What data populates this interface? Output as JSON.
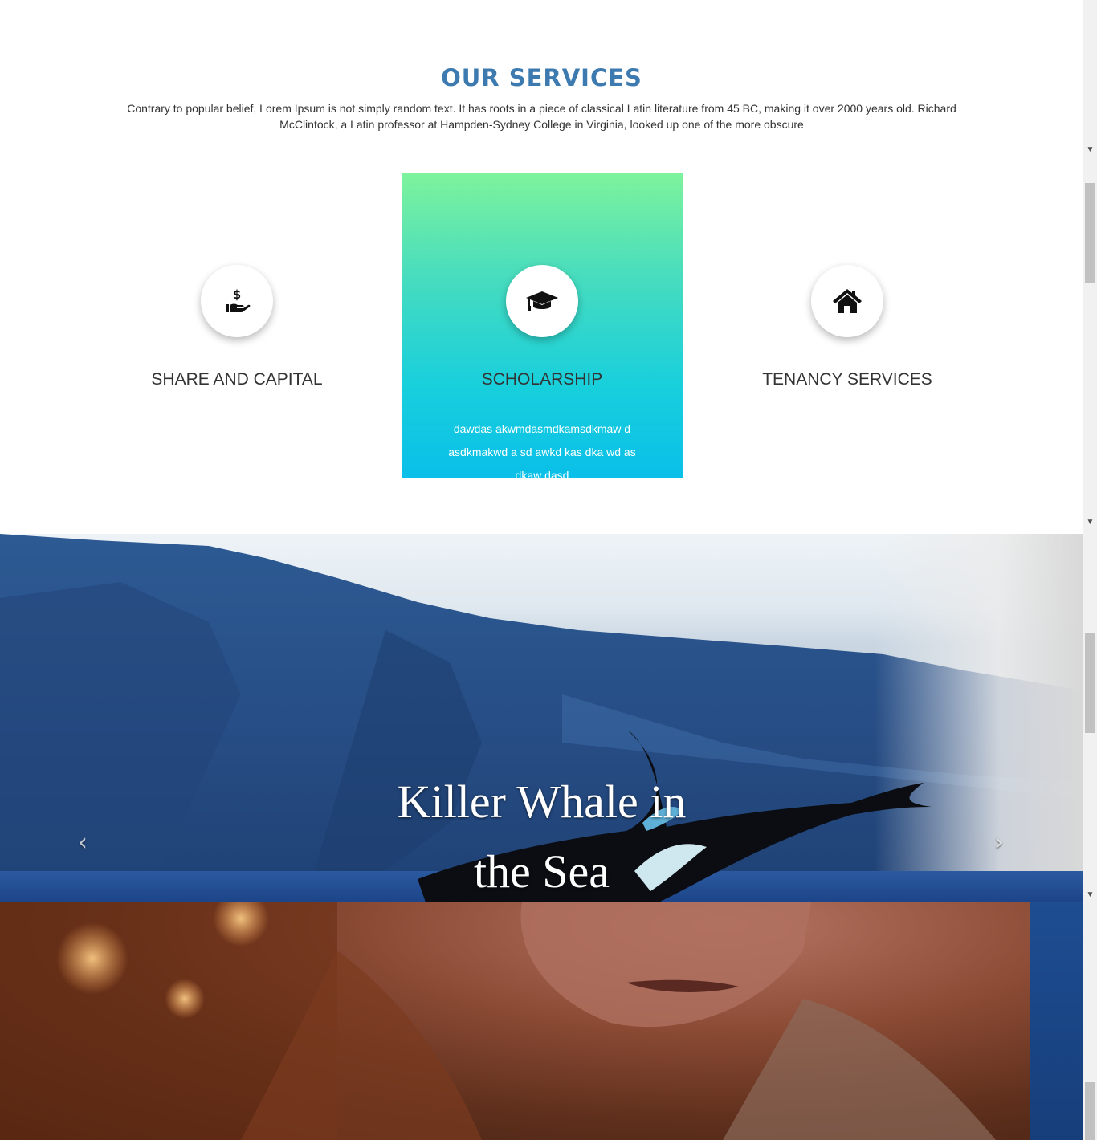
{
  "services": {
    "title": "OUR SERVICES",
    "description": "Contrary to popular belief, Lorem Ipsum is not simply random text. It has roots in a piece of classical Latin literature from 45 BC, making it over 2000 years old. Richard McClintock, a Latin professor at Hampden-Sydney College in Virginia, looked up one of the more obscure",
    "cards": [
      {
        "title": "SHARE AND CAPITAL",
        "icon": "hand-dollar-icon"
      },
      {
        "title": "SCHOLARSHIP",
        "icon": "graduation-cap-icon",
        "text": "dawdas akwmdasmdkamsdkmaw d asdkmakwd a sd awkd kas dka wd as dkaw dasd",
        "gradient": [
          "#7ef39c",
          "#0abfe8"
        ]
      },
      {
        "title": "TENANCY SERVICES",
        "icon": "home-icon"
      }
    ]
  },
  "carousel": {
    "caption_line1": "Killer Whale in",
    "caption_line2": "the Sea",
    "prev_icon": "chevron-left-icon",
    "next_icon": "chevron-right-icon"
  },
  "colors": {
    "title": "#3c7ab0",
    "card_text": "#ffffff"
  }
}
